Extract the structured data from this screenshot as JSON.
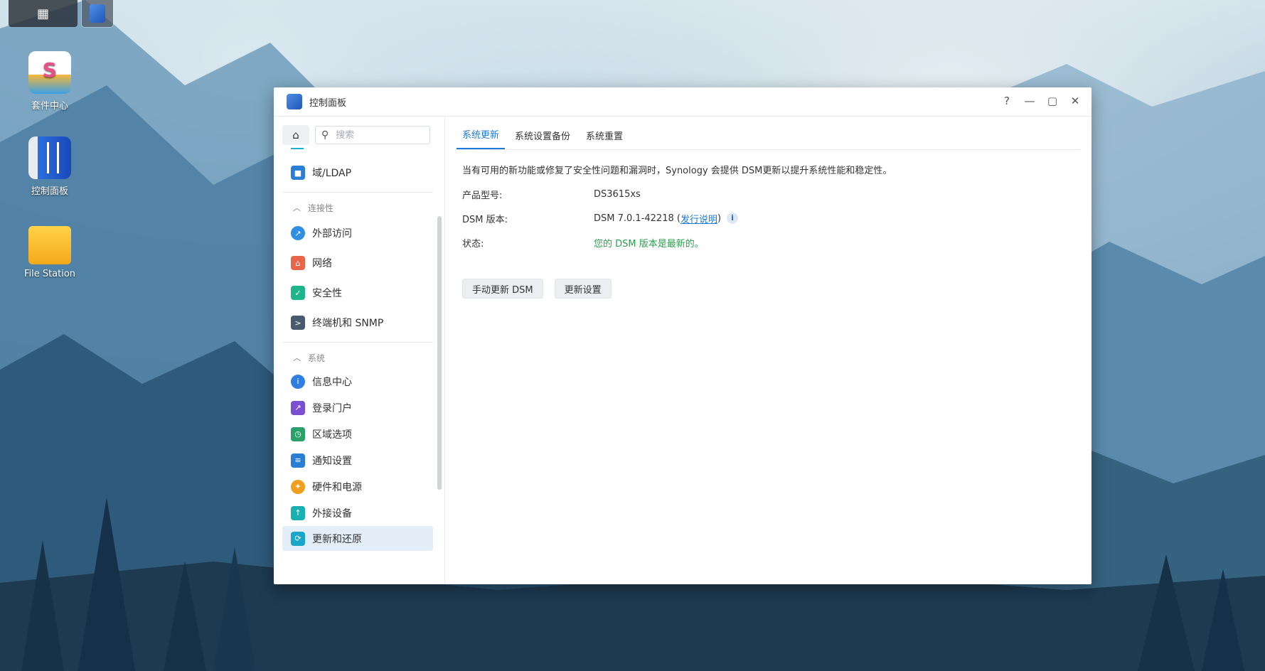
{
  "taskbar": {
    "main_menu_icon": "grid-icon",
    "active_app_icon": "control-panel-icon"
  },
  "desktop": {
    "icons": [
      {
        "label": "套件中心",
        "icon": "package-center-icon"
      },
      {
        "label": "控制面板",
        "icon": "control-panel-icon"
      },
      {
        "label": "File Station",
        "icon": "folder-icon"
      }
    ]
  },
  "window": {
    "title": "控制面板",
    "controls": {
      "help": "?",
      "minimize": "—",
      "maximize": "▢",
      "close": "✕"
    }
  },
  "sidebar": {
    "search_placeholder": "搜索",
    "top_item": {
      "label": "域/LDAP",
      "icon": "domain-ldap-icon",
      "color": "#2a7fd4"
    },
    "sections": [
      {
        "title": "连接性",
        "items": [
          {
            "label": "外部访问",
            "icon": "external-access-icon",
            "color": "#2f8fe0"
          },
          {
            "label": "网络",
            "icon": "network-icon",
            "color": "#e8664a"
          },
          {
            "label": "安全性",
            "icon": "shield-icon",
            "color": "#1fb58a"
          },
          {
            "label": "终端机和 SNMP",
            "icon": "terminal-icon",
            "color": "#4a5a6e"
          }
        ]
      },
      {
        "title": "系统",
        "items": [
          {
            "label": "信息中心",
            "icon": "info-center-icon",
            "color": "#2f7fe0"
          },
          {
            "label": "登录门户",
            "icon": "login-portal-icon",
            "color": "#7a4fd0"
          },
          {
            "label": "区域选项",
            "icon": "regional-options-icon",
            "color": "#2aa06a"
          },
          {
            "label": "通知设置",
            "icon": "notification-icon",
            "color": "#2a7fd4"
          },
          {
            "label": "硬件和电源",
            "icon": "bulb-icon",
            "color": "#f0a020"
          },
          {
            "label": "外接设备",
            "icon": "external-device-icon",
            "color": "#18b0b0"
          },
          {
            "label": "更新和还原",
            "icon": "update-restore-icon",
            "color": "#1aa6c8"
          }
        ]
      }
    ]
  },
  "main": {
    "tabs": [
      "系统更新",
      "系统设置备份",
      "系统重置"
    ],
    "description": "当有可用的新功能或修复了安全性问题和漏洞时，Synology 会提供 DSM更新以提升系统性能和稳定性。",
    "fields": {
      "model_label": "产品型号:",
      "model_value": "DS3615xs",
      "version_label": "DSM 版本:",
      "version_value": "DSM 7.0.1-42218 (",
      "release_notes": "发行说明",
      "version_suffix": ")",
      "status_label": "状态:",
      "status_value": "您的 DSM 版本是最新的。"
    },
    "buttons": {
      "manual_update": "手动更新 DSM",
      "update_settings": "更新设置"
    },
    "colors": {
      "accent": "#1e7ad6",
      "ok": "#2aa04a"
    }
  }
}
